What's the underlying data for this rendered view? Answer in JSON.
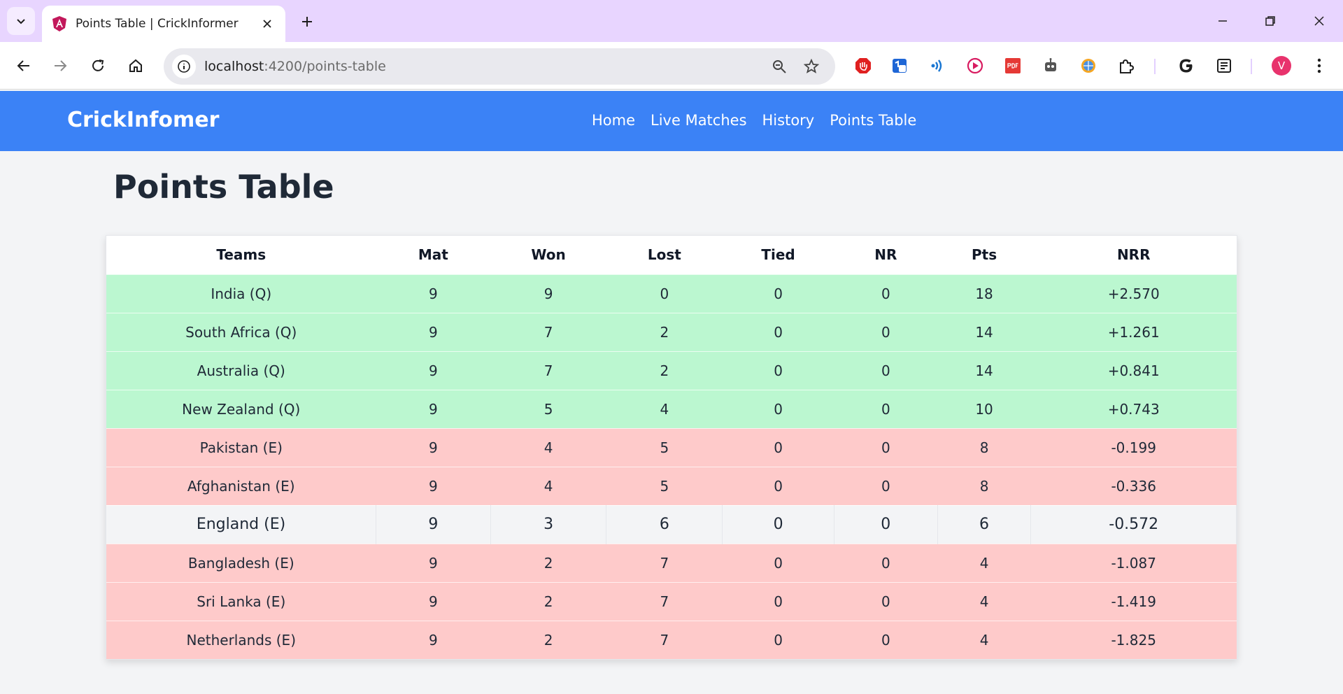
{
  "browser": {
    "tab_title": "Points Table | CrickInformer",
    "url_host": "localhost",
    "url_rest": ":4200/points-table",
    "profile_initial": "V"
  },
  "site": {
    "brand": "CrickInfomer",
    "nav": [
      "Home",
      "Live Matches",
      "History",
      "Points Table"
    ]
  },
  "page": {
    "title": "Points Table"
  },
  "table": {
    "headers": [
      "Teams",
      "Mat",
      "Won",
      "Lost",
      "Tied",
      "NR",
      "Pts",
      "NRR"
    ],
    "rows": [
      {
        "status": "q",
        "cells": [
          "India (Q)",
          "9",
          "9",
          "0",
          "0",
          "0",
          "18",
          "+2.570"
        ]
      },
      {
        "status": "q",
        "cells": [
          "South Africa (Q)",
          "9",
          "7",
          "2",
          "0",
          "0",
          "14",
          "+1.261"
        ]
      },
      {
        "status": "q",
        "cells": [
          "Australia (Q)",
          "9",
          "7",
          "2",
          "0",
          "0",
          "14",
          "+0.841"
        ]
      },
      {
        "status": "q",
        "cells": [
          "New Zealand (Q)",
          "9",
          "5",
          "4",
          "0",
          "0",
          "10",
          "+0.743"
        ]
      },
      {
        "status": "e",
        "cells": [
          "Pakistan (E)",
          "9",
          "4",
          "5",
          "0",
          "0",
          "8",
          "-0.199"
        ]
      },
      {
        "status": "e",
        "cells": [
          "Afghanistan (E)",
          "9",
          "4",
          "5",
          "0",
          "0",
          "8",
          "-0.336"
        ]
      },
      {
        "status": "plain",
        "cells": [
          "England (E)",
          "9",
          "3",
          "6",
          "0",
          "0",
          "6",
          "-0.572"
        ]
      },
      {
        "status": "e",
        "cells": [
          "Bangladesh (E)",
          "9",
          "2",
          "7",
          "0",
          "0",
          "4",
          "-1.087"
        ]
      },
      {
        "status": "e",
        "cells": [
          "Sri Lanka (E)",
          "9",
          "2",
          "7",
          "0",
          "0",
          "4",
          "-1.419"
        ]
      },
      {
        "status": "e",
        "cells": [
          "Netherlands (E)",
          "9",
          "2",
          "7",
          "0",
          "0",
          "4",
          "-1.825"
        ]
      }
    ]
  },
  "colors": {
    "nav_bg": "#3b82f6",
    "qualified_row": "#bbf7d0",
    "eliminated_row": "#fecaca",
    "tabstrip": "#e8d5ff"
  }
}
